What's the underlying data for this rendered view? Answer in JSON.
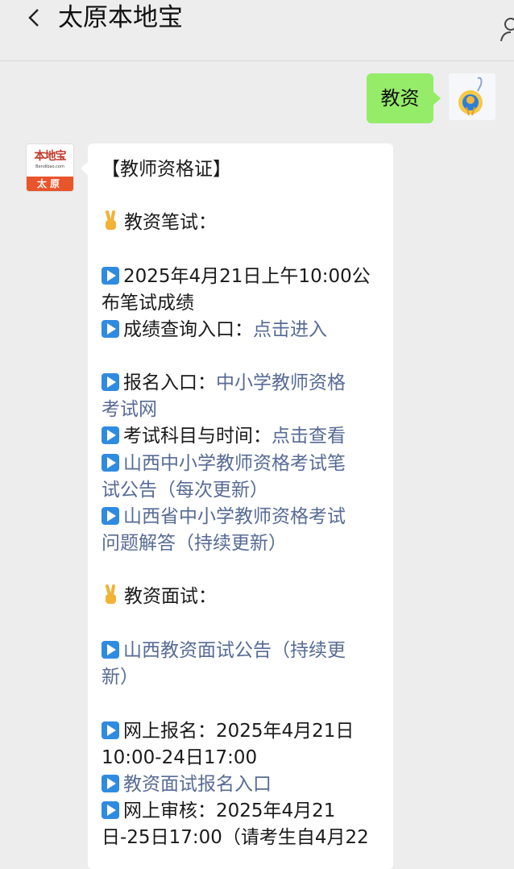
{
  "header": {
    "title": "太原本地宝"
  },
  "outgoing": {
    "message": "教资"
  },
  "bot_avatar": {
    "brand": "本地宝",
    "domain": "Bendibao.com",
    "city": "太原"
  },
  "message": {
    "heading": "【教师资格证】",
    "section1_title": "教资笔试：",
    "l1a": "2025年4月21日上午10:00公",
    "l1b": "布笔试成绩",
    "l2_text": "成绩查询入口：",
    "l2_link": "点击进入",
    "l3_text": "报名入口：",
    "l3_link_a": "中小学教师资格",
    "l3_link_b": "考试网",
    "l4_text": "考试科目与时间：",
    "l4_link": "点击查看",
    "l5a": "山西中小学教师资格考试笔",
    "l5b": "试公告（每次更新）",
    "l6a": "山西省中小学教师资格考试",
    "l6b": "问题解答（持续更新）",
    "section2_title": "教资面试：",
    "l7a": "山西教资面试公告（持续更",
    "l7b": "新）",
    "l8a": "网上报名：2025年4月21日",
    "l8b": "10:00-24日17:00",
    "l9": "教资面试报名入口",
    "l10a": "网上审核：2025年4月21",
    "l10b": "日-25日17:00（请考生自4月22"
  },
  "colors": {
    "link": "#576b95",
    "outgoing_bubble": "#95ec69",
    "play_icon": "#2f8be0"
  }
}
